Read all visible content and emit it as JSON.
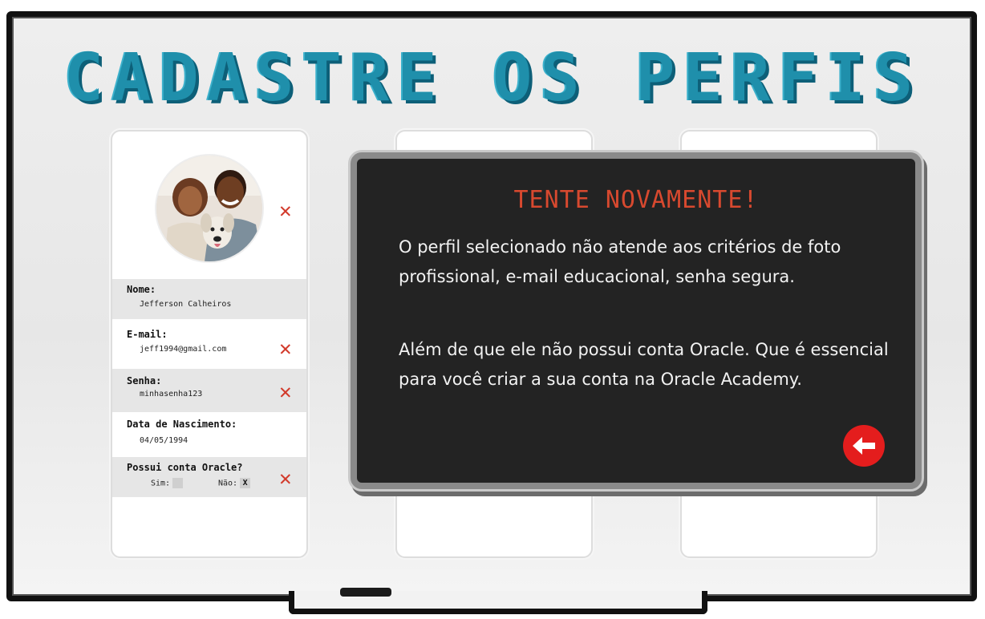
{
  "title": "CADASTRE OS PERFIS",
  "profile": {
    "avatar_alt": "",
    "fields": {
      "name_label": "Nome:",
      "name_value": "Jefferson Calheiros",
      "email_label": "E-mail:",
      "email_value": "jeff1994@gmail.com",
      "password_label": "Senha:",
      "password_value": "minhasenha123",
      "birth_label": "Data de Nascimento:",
      "birth_value": "04/05/1994",
      "oracle_label": "Possui conta Oracle?",
      "yes_label": "Sim:",
      "no_label": "Não:",
      "no_mark": "X"
    },
    "error_mark": "✕"
  },
  "modal": {
    "title": "TENTE NOVAMENTE!",
    "paragraph1": "O perfil selecionado não atende aos critérios de foto profissional, e-mail educacional, senha segura.",
    "paragraph2": "Além de que ele não possui conta Oracle. Que é essencial para você criar a sua conta na Oracle Academy."
  },
  "colors": {
    "title": "#1f8fab",
    "modal_title": "#d8492f",
    "error": "#d23a2b",
    "back_button": "#e41d1d"
  },
  "icons": {
    "back": "arrow-left-icon",
    "error": "x-icon"
  }
}
